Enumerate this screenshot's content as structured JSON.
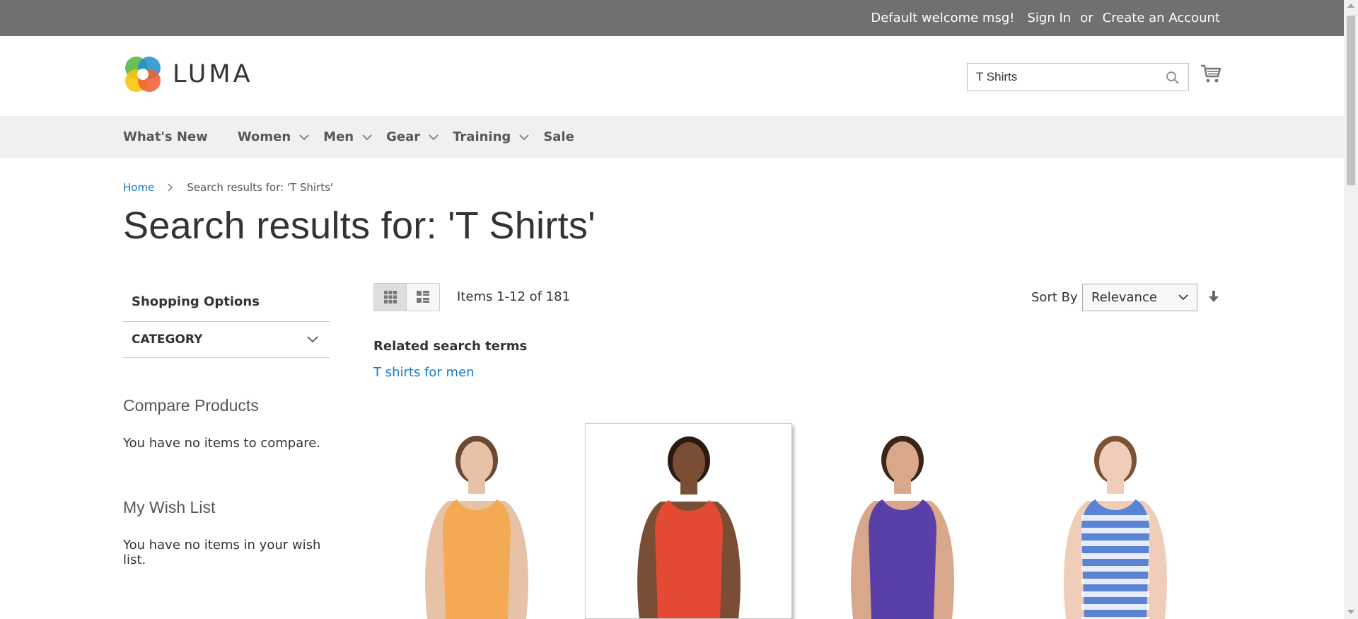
{
  "topbar": {
    "welcome": "Default welcome msg!",
    "sign_in": "Sign In",
    "or": "or",
    "create_account": "Create an Account"
  },
  "header": {
    "logo_text": "LUMA",
    "search_value": "T Shirts",
    "search_icon": "search-icon",
    "cart_icon": "cart-icon"
  },
  "nav": {
    "items": [
      {
        "label": "What's New",
        "has_submenu": false
      },
      {
        "label": "Women",
        "has_submenu": true
      },
      {
        "label": "Men",
        "has_submenu": true
      },
      {
        "label": "Gear",
        "has_submenu": true
      },
      {
        "label": "Training",
        "has_submenu": true
      },
      {
        "label": "Sale",
        "has_submenu": false
      }
    ]
  },
  "breadcrumb": {
    "home": "Home",
    "current": "Search results for: 'T Shirts'"
  },
  "page_title": "Search results for: 'T Shirts'",
  "sidebar": {
    "shopping_options": "Shopping Options",
    "category": "CATEGORY",
    "compare_title": "Compare Products",
    "compare_empty": "You have no items to compare.",
    "wishlist_title": "My Wish List",
    "wishlist_empty": "You have no items in your wish list."
  },
  "toolbar": {
    "view_modes": [
      "grid-icon",
      "list-icon"
    ],
    "active_mode": "grid",
    "amount": "Items 1-12 of 181",
    "sort_label": "Sort By",
    "sort_value": "Relevance",
    "sort_direction_icon": "arrow-down-icon"
  },
  "related": {
    "title": "Related search terms",
    "link": "T shirts for men"
  },
  "products": [
    {
      "image": "woman-orange-tank-top",
      "shirt_color": "#f4aa55",
      "skin": "#e8c2a6",
      "hair": "#6a4a35",
      "hovered": false
    },
    {
      "image": "man-red-sleeveless-shirt",
      "shirt_color": "#e34a33",
      "skin": "#7a4d35",
      "hair": "#2a1a12",
      "hovered": true
    },
    {
      "image": "woman-purple-tank-top",
      "shirt_color": "#5a3fa8",
      "skin": "#d9a88a",
      "hair": "#3b2418",
      "hovered": false
    },
    {
      "image": "woman-blue-striped-tank-top",
      "shirt_color": "#5b83d4",
      "skin": "#efcdb8",
      "hair": "#7b5234",
      "hovered": false
    }
  ],
  "colors": {
    "topbar_bg": "#6e716e",
    "nav_bg": "#f0f0f0",
    "link_blue": "#1979c3"
  }
}
